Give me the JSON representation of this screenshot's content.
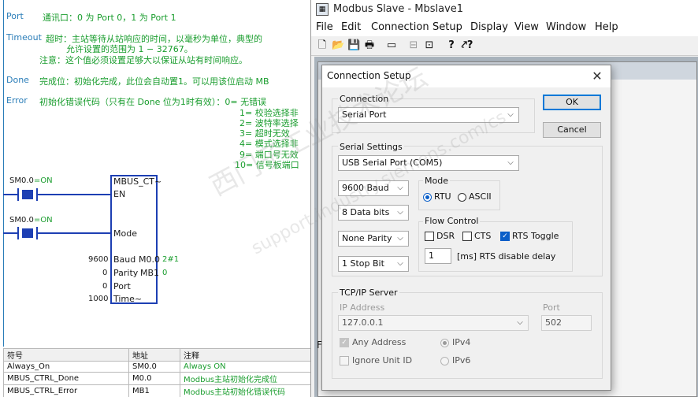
{
  "ladder": {
    "notes": [
      {
        "label": "Port",
        "text": "通讯口：0 为 Port 0，1 为 Port 1"
      },
      {
        "label": "Timeout",
        "text": "超时：主站等待从站响应的时间，以毫秒为单位，典型的",
        "text2": "允许设置的范围为 1 − 32767。",
        "text3": "注意：这个值必须设置足够大以保证从站有时间响应。"
      },
      {
        "label": "Done",
        "text": "完成位：初始化完成，此位会自动置1。可以用该位启动 MB"
      },
      {
        "label": "Error",
        "text": "初始化错误代码（只有在 Done 位为1时有效）：0= 无错误"
      }
    ],
    "error_codes": [
      "1= 校验选择非",
      "2= 波特率选择",
      "3= 超时无效",
      "4= 模式选择非",
      "9= 端口号无效",
      "10= 信号板端口"
    ],
    "contact1": {
      "addr": "SM0.0",
      "state": "=ON"
    },
    "contact2": {
      "addr": "SM0.0",
      "state": "=ON"
    },
    "block": {
      "title": "MBUS_CT~",
      "en": "EN",
      "mode": "Mode",
      "baud": "Baud",
      "parity": "Parity",
      "port": "Port",
      "time": "Time~",
      "mb0": "M0.0",
      "mb0_val": "2#1",
      "mb1": "MB1",
      "mb1_val": "0"
    },
    "block_inputs": {
      "baud": "9600",
      "parity": "0",
      "port": "0",
      "time": "1000"
    },
    "symbols": {
      "headers": [
        "符号",
        "地址",
        "注释"
      ],
      "rows": [
        [
          "Always_On",
          "SM0.0",
          "Always ON"
        ],
        [
          "MBUS_CTRL_Done",
          "M0.0",
          "Modbus主站初始化完成位"
        ],
        [
          "MBUS_CTRL_Error",
          "MB1",
          "Modbus主站初始化错误代码"
        ]
      ]
    }
  },
  "mbslave": {
    "title": "Modbus Slave - Mbslave1",
    "menu": [
      "File",
      "Edit",
      "Connection",
      "Setup",
      "Display",
      "View",
      "Window",
      "Help"
    ],
    "client_stub": "Fo"
  },
  "dialog": {
    "title": "Connection Setup",
    "connection_label": "Connection",
    "connection_value": "Serial Port",
    "ok_label": "OK",
    "cancel_label": "Cancel",
    "serial_settings_label": "Serial Settings",
    "port_value": "USB Serial Port (COM5)",
    "baud_value": "9600 Baud",
    "data_bits_value": "8 Data bits",
    "parity_value": "None Parity",
    "stop_bits_value": "1 Stop Bit",
    "mode_label": "Mode",
    "mode_rtu": "RTU",
    "mode_ascii": "ASCII",
    "flow_label": "Flow Control",
    "dsr": "DSR",
    "cts": "CTS",
    "rts_toggle": "RTS Toggle",
    "rts_delay_value": "1",
    "rts_delay_label": "[ms] RTS disable delay",
    "tcp_label": "TCP/IP Server",
    "ip_label": "IP Address",
    "ip_value": "127.0.0.1",
    "port_label": "Port",
    "tcp_port_value": "502",
    "any_address": "Any Address",
    "ignore_unit": "Ignore Unit ID",
    "ipv4": "IPv4",
    "ipv6": "IPv6"
  },
  "watermark": {
    "line1": "西门子工业技术论坛",
    "line2": "support.industry.siemens.com/cs"
  }
}
